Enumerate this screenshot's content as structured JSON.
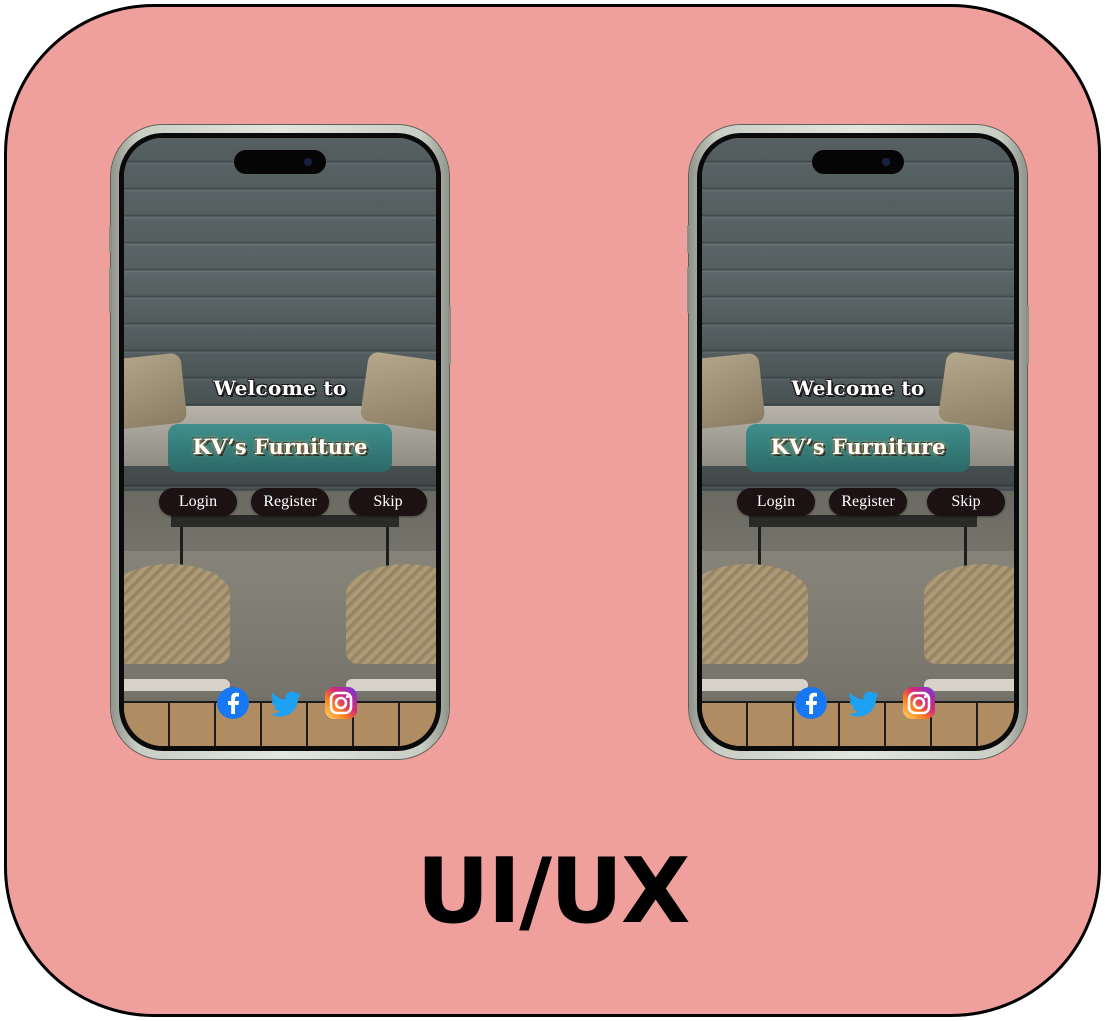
{
  "card": {
    "background": "#efa09c",
    "border": "#000000"
  },
  "phones": [
    {
      "welcome": "Welcome to",
      "brand": "KV’s Furniture",
      "buttons": {
        "login": "Login",
        "register": "Register",
        "skip": "Skip"
      },
      "social": [
        "facebook-icon",
        "twitter-icon",
        "instagram-icon"
      ]
    },
    {
      "welcome": "Welcome to",
      "brand": "KV’s Furniture",
      "buttons": {
        "login": "Login",
        "register": "Register",
        "skip": "Skip"
      },
      "social": [
        "facebook-icon",
        "twitter-icon",
        "instagram-icon"
      ]
    }
  ],
  "title": "UI/UX",
  "colors": {
    "button_bg": "#1c1213",
    "facebook": "#1877f2",
    "twitter": "#1da1f2"
  }
}
